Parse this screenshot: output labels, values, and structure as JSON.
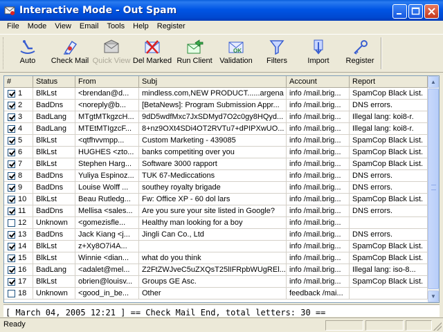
{
  "window": {
    "title": "Interactive Mode - Out Spam"
  },
  "menu": [
    "File",
    "Mode",
    "View",
    "Email",
    "Tools",
    "Help",
    "Register"
  ],
  "toolbar": [
    {
      "label": "Auto",
      "icon": "auto-icon",
      "enabled": true
    },
    {
      "label": "Check Mail",
      "icon": "check-mail-icon",
      "enabled": true
    },
    {
      "label": "Quick View",
      "icon": "quick-view-icon",
      "enabled": false
    },
    {
      "label": "Del Marked",
      "icon": "delete-marked-icon",
      "enabled": true
    },
    {
      "label": "Run Client",
      "icon": "run-client-icon",
      "enabled": true
    },
    {
      "label": "Validation",
      "icon": "validation-icon",
      "enabled": true
    },
    {
      "label": "Filters",
      "icon": "filter-icon",
      "enabled": true
    },
    {
      "label": "Import",
      "icon": "import-icon",
      "enabled": true
    },
    {
      "label": "Register",
      "icon": "key-icon",
      "enabled": true
    }
  ],
  "columns": [
    "#",
    "Status",
    "From",
    "Subj",
    "Account",
    "Report"
  ],
  "rows": [
    {
      "checked": true,
      "num": "1",
      "status": "BlkLst",
      "from": "<brendan@d...",
      "subj": "mindless.com,NEW PRODUCT......argena",
      "account": "info /mail.brig...",
      "report": "SpamCop Black List."
    },
    {
      "checked": true,
      "num": "2",
      "status": "BadDns",
      "from": "<noreply@b...",
      "subj": "[BetaNews]: Program Submission Appr...",
      "account": "info /mail.brig...",
      "report": "DNS errors."
    },
    {
      "checked": true,
      "num": "3",
      "status": "BadLang",
      "from": "MTgtMTkgzcH...",
      "subj": "9dD5wdfMxc7JxSDMyd7O2c0gy8HQyd...",
      "account": "info /mail.brig...",
      "report": "Illegal lang: koi8-r."
    },
    {
      "checked": true,
      "num": "4",
      "status": "BadLang",
      "from": "MTEtMTIgzcF...",
      "subj": "8+nz9OXt4SDi4OT2RVTu7+dPIPXwUO...",
      "account": "info /mail.brig...",
      "report": "Illegal lang: koi8-r."
    },
    {
      "checked": true,
      "num": "5",
      "status": "BlkLst",
      "from": "<qtfhvvmpp...",
      "subj": "Custom Marketing - 439085",
      "account": "info /mail.brig...",
      "report": "SpamCop Black List."
    },
    {
      "checked": true,
      "num": "6",
      "status": "BlkLst",
      "from": "HUGHES <zto...",
      "subj": "banks competiting over you",
      "account": "info /mail.brig...",
      "report": "SpamCop Black List."
    },
    {
      "checked": true,
      "num": "7",
      "status": "BlkLst",
      "from": "Stephen Harg...",
      "subj": "Software 3000 rapport",
      "account": "info /mail.brig...",
      "report": "SpamCop Black List."
    },
    {
      "checked": true,
      "num": "8",
      "status": "BadDns",
      "from": "Yuliya Espinoz...",
      "subj": "TUK 67-Medicсations",
      "account": "info /mail.brig...",
      "report": "DNS errors."
    },
    {
      "checked": true,
      "num": "9",
      "status": "BadDns",
      "from": "Louise Wolff ...",
      "subj": "southey royalty brigade",
      "account": "info /mail.brig...",
      "report": "DNS errors."
    },
    {
      "checked": true,
      "num": "10",
      "status": "BlkLst",
      "from": "Beau Rutledg...",
      "subj": "Fw: Office XP - 60 dol lars",
      "account": "info /mail.brig...",
      "report": "SpamCop Black List."
    },
    {
      "checked": true,
      "num": "11",
      "status": "BadDns",
      "from": "Mellisa <sales...",
      "subj": "Are you sure your site listed in Google?",
      "account": "info /mail.brig...",
      "report": "DNS errors."
    },
    {
      "checked": false,
      "num": "12",
      "status": "Unknown",
      "from": "<gomezisfle...",
      "subj": "Healthy man looking for a boy",
      "account": "info /mail.brig...",
      "report": ""
    },
    {
      "checked": true,
      "num": "13",
      "status": "BadDns",
      "from": "Jack Kiang <j...",
      "subj": "Jingli Can Co., Ltd",
      "account": "info /mail.brig...",
      "report": "DNS errors."
    },
    {
      "checked": true,
      "num": "14",
      "status": "BlkLst",
      "from": "z+Xy8O7i4A...",
      "subj": "",
      "account": "info /mail.brig...",
      "report": "SpamCop Black List."
    },
    {
      "checked": true,
      "num": "15",
      "status": "BlkLst",
      "from": "Winnie <dian...",
      "subj": "what do you think",
      "account": "info /mail.brig...",
      "report": "SpamCop Black List."
    },
    {
      "checked": true,
      "num": "16",
      "status": "BadLang",
      "from": "<adalet@mel...",
      "subj": "Z2FtZWJveC5uZXQsT25lIFRpbWUgREl...",
      "account": "info /mail.brig...",
      "report": "Illegal lang: iso-8..."
    },
    {
      "checked": true,
      "num": "17",
      "status": "BlkLst",
      "from": "obrien@louisv...",
      "subj": "Groups  GE Asc.",
      "account": "info /mail.brig...",
      "report": "SpamCop Black List."
    },
    {
      "checked": false,
      "num": "18",
      "status": "Unknown",
      "from": "<good_in_be...",
      "subj": "Other",
      "account": "feedback /mai...",
      "report": ""
    }
  ],
  "log": {
    "text": "[ March 04, 2005 12:21 ]       == Check Mail End, total letters: 30 =="
  },
  "status": {
    "text": "Ready"
  }
}
